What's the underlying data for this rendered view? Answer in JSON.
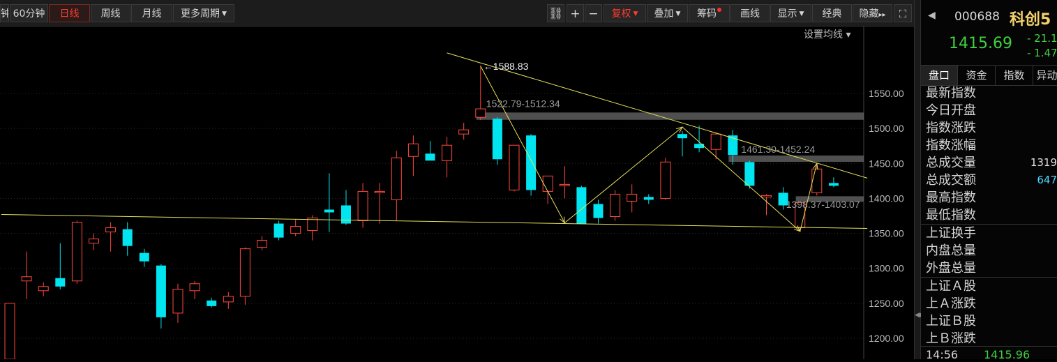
{
  "toolbar": {
    "buttons": [
      {
        "label": "钟",
        "name": "period-minute-partial"
      },
      {
        "label": "60分钟",
        "name": "period-60min"
      },
      {
        "label": "日线",
        "name": "period-day",
        "active": true
      },
      {
        "label": "周线",
        "name": "period-week"
      },
      {
        "label": "月线",
        "name": "period-month"
      },
      {
        "label": "更多周期",
        "name": "period-more",
        "caret": true
      }
    ],
    "right_buttons": [
      {
        "label": "复权",
        "name": "fuquan-button",
        "caret": true,
        "red": true
      },
      {
        "label": "叠加",
        "name": "overlay-button",
        "caret": true
      },
      {
        "label": "筹码",
        "name": "chips-button",
        "dot": true
      },
      {
        "label": "画线",
        "name": "draw-line-button"
      },
      {
        "label": "显示",
        "name": "display-button",
        "caret": true
      },
      {
        "label": "经典",
        "name": "classic-button"
      },
      {
        "label": "隐藏",
        "name": "hide-button",
        "suffix": "▸▸"
      }
    ],
    "icons": {
      "lock": "⛓",
      "zoom_in": "+",
      "zoom_out": "−",
      "fullscreen": "⛶"
    }
  },
  "chart": {
    "settings_label": "设置均线",
    "annotations": {
      "peak": "1588.83",
      "zone_top": "1522.79-1512.34",
      "zone_mid": "1461.30-1452.24",
      "zone_low": "1398.37-1403.07"
    }
  },
  "chart_data": {
    "type": "candlestick",
    "y_ticks": [
      1200,
      1250,
      1300,
      1350,
      1400,
      1450,
      1500,
      1550
    ],
    "y_tick_labels": [
      "1200.00",
      "1250.00",
      "1300.00",
      "1350.00",
      "1400.00",
      "1450.00",
      "1500.00",
      "1550.00"
    ],
    "ylim": [
      1170,
      1610
    ],
    "colors": {
      "up": "#ff4a3d",
      "down": "#00e5f0",
      "trend": "#e6e05a",
      "zone": "#6a6a6a"
    },
    "candles": [
      {
        "o": 1170,
        "h": 1250,
        "l": 1165,
        "c": 1250
      },
      {
        "o": 1282,
        "h": 1324,
        "l": 1256,
        "c": 1288
      },
      {
        "o": 1268,
        "h": 1280,
        "l": 1260,
        "c": 1274
      },
      {
        "o": 1286,
        "h": 1336,
        "l": 1270,
        "c": 1274
      },
      {
        "o": 1282,
        "h": 1368,
        "l": 1278,
        "c": 1366
      },
      {
        "o": 1336,
        "h": 1350,
        "l": 1326,
        "c": 1342
      },
      {
        "o": 1352,
        "h": 1366,
        "l": 1324,
        "c": 1358
      },
      {
        "o": 1356,
        "h": 1366,
        "l": 1318,
        "c": 1332
      },
      {
        "o": 1322,
        "h": 1328,
        "l": 1302,
        "c": 1310
      },
      {
        "o": 1304,
        "h": 1306,
        "l": 1214,
        "c": 1230
      },
      {
        "o": 1236,
        "h": 1278,
        "l": 1222,
        "c": 1270
      },
      {
        "o": 1268,
        "h": 1282,
        "l": 1256,
        "c": 1278
      },
      {
        "o": 1254,
        "h": 1258,
        "l": 1244,
        "c": 1246
      },
      {
        "o": 1252,
        "h": 1266,
        "l": 1242,
        "c": 1260
      },
      {
        "o": 1260,
        "h": 1330,
        "l": 1248,
        "c": 1328
      },
      {
        "o": 1330,
        "h": 1346,
        "l": 1326,
        "c": 1340
      },
      {
        "o": 1364,
        "h": 1368,
        "l": 1340,
        "c": 1344
      },
      {
        "o": 1350,
        "h": 1370,
        "l": 1346,
        "c": 1360
      },
      {
        "o": 1354,
        "h": 1376,
        "l": 1340,
        "c": 1372
      },
      {
        "o": 1384,
        "h": 1436,
        "l": 1352,
        "c": 1380
      },
      {
        "o": 1390,
        "h": 1412,
        "l": 1362,
        "c": 1364
      },
      {
        "o": 1368,
        "h": 1422,
        "l": 1358,
        "c": 1410
      },
      {
        "o": 1408,
        "h": 1422,
        "l": 1364,
        "c": 1410
      },
      {
        "o": 1398,
        "h": 1468,
        "l": 1368,
        "c": 1458
      },
      {
        "o": 1460,
        "h": 1490,
        "l": 1432,
        "c": 1478
      },
      {
        "o": 1464,
        "h": 1482,
        "l": 1458,
        "c": 1454
      },
      {
        "o": 1454,
        "h": 1488,
        "l": 1430,
        "c": 1476
      },
      {
        "o": 1492,
        "h": 1508,
        "l": 1484,
        "c": 1498
      },
      {
        "o": 1516,
        "h": 1590,
        "l": 1512,
        "c": 1528
      },
      {
        "o": 1514,
        "h": 1516,
        "l": 1448,
        "c": 1456
      },
      {
        "o": 1412,
        "h": 1476,
        "l": 1410,
        "c": 1476
      },
      {
        "o": 1490,
        "h": 1492,
        "l": 1404,
        "c": 1412
      },
      {
        "o": 1410,
        "h": 1432,
        "l": 1392,
        "c": 1432
      },
      {
        "o": 1418,
        "h": 1446,
        "l": 1400,
        "c": 1420
      },
      {
        "o": 1416,
        "h": 1418,
        "l": 1364,
        "c": 1364
      },
      {
        "o": 1392,
        "h": 1398,
        "l": 1364,
        "c": 1372
      },
      {
        "o": 1374,
        "h": 1412,
        "l": 1368,
        "c": 1406
      },
      {
        "o": 1396,
        "h": 1420,
        "l": 1380,
        "c": 1406
      },
      {
        "o": 1402,
        "h": 1406,
        "l": 1392,
        "c": 1398
      },
      {
        "o": 1400,
        "h": 1458,
        "l": 1398,
        "c": 1452
      },
      {
        "o": 1492,
        "h": 1496,
        "l": 1460,
        "c": 1486
      },
      {
        "o": 1478,
        "h": 1504,
        "l": 1466,
        "c": 1472
      },
      {
        "o": 1470,
        "h": 1494,
        "l": 1456,
        "c": 1492
      },
      {
        "o": 1490,
        "h": 1498,
        "l": 1448,
        "c": 1462
      },
      {
        "o": 1452,
        "h": 1454,
        "l": 1414,
        "c": 1418
      },
      {
        "o": 1402,
        "h": 1406,
        "l": 1376,
        "c": 1404
      },
      {
        "o": 1408,
        "h": 1416,
        "l": 1384,
        "c": 1390
      },
      {
        "o": 1358,
        "h": 1394,
        "l": 1352,
        "c": 1394
      },
      {
        "o": 1408,
        "h": 1446,
        "l": 1404,
        "c": 1442
      },
      {
        "o": 1422,
        "h": 1430,
        "l": 1416,
        "c": 1418
      }
    ],
    "zones": [
      {
        "lo": 1512.34,
        "hi": 1522.79,
        "from": 28
      },
      {
        "lo": 1452.24,
        "hi": 1461.3,
        "from": 43
      },
      {
        "lo": 1398.37,
        "hi": 1403.07,
        "from": 47
      }
    ],
    "trendlines": [
      [
        [
          -0.5,
          1377
        ],
        [
          51,
          1357
        ]
      ],
      [
        [
          26,
          1608
        ],
        [
          51,
          1429
        ]
      ]
    ],
    "zigzag": [
      [
        28,
        1589
      ],
      [
        33,
        1365
      ],
      [
        40,
        1502
      ],
      [
        47,
        1353
      ],
      [
        48,
        1450
      ]
    ]
  },
  "sidebar": {
    "code": "000688",
    "name": "科创5",
    "price": "1415.69",
    "change": "- 21.1",
    "change_pct": "- 1.47",
    "tabs": [
      "盘口",
      "资金",
      "指数",
      "异动"
    ],
    "rows_a": [
      {
        "label": "最新指数",
        "value": ""
      },
      {
        "label": "今日开盘",
        "value": ""
      },
      {
        "label": "指数涨跌",
        "value": ""
      },
      {
        "label": "指数涨幅",
        "value": ""
      },
      {
        "label": "总成交量",
        "value": "1319"
      },
      {
        "label": "总成交额",
        "value": "647"
      },
      {
        "label": "最高指数",
        "value": ""
      },
      {
        "label": "最低指数",
        "value": ""
      }
    ],
    "rows_b": [
      {
        "label": "上证换手",
        "value": ""
      },
      {
        "label": "内盘总量",
        "value": ""
      },
      {
        "label": "外盘总量",
        "value": ""
      }
    ],
    "rows_c": [
      {
        "label": "上证Ａ股",
        "value": ""
      },
      {
        "label": "上Ａ涨跌",
        "value": ""
      },
      {
        "label": "上证Ｂ股",
        "value": ""
      },
      {
        "label": "上Ｂ涨跌",
        "value": ""
      }
    ],
    "footer_time": "14:56",
    "footer_price": "1415.96"
  }
}
